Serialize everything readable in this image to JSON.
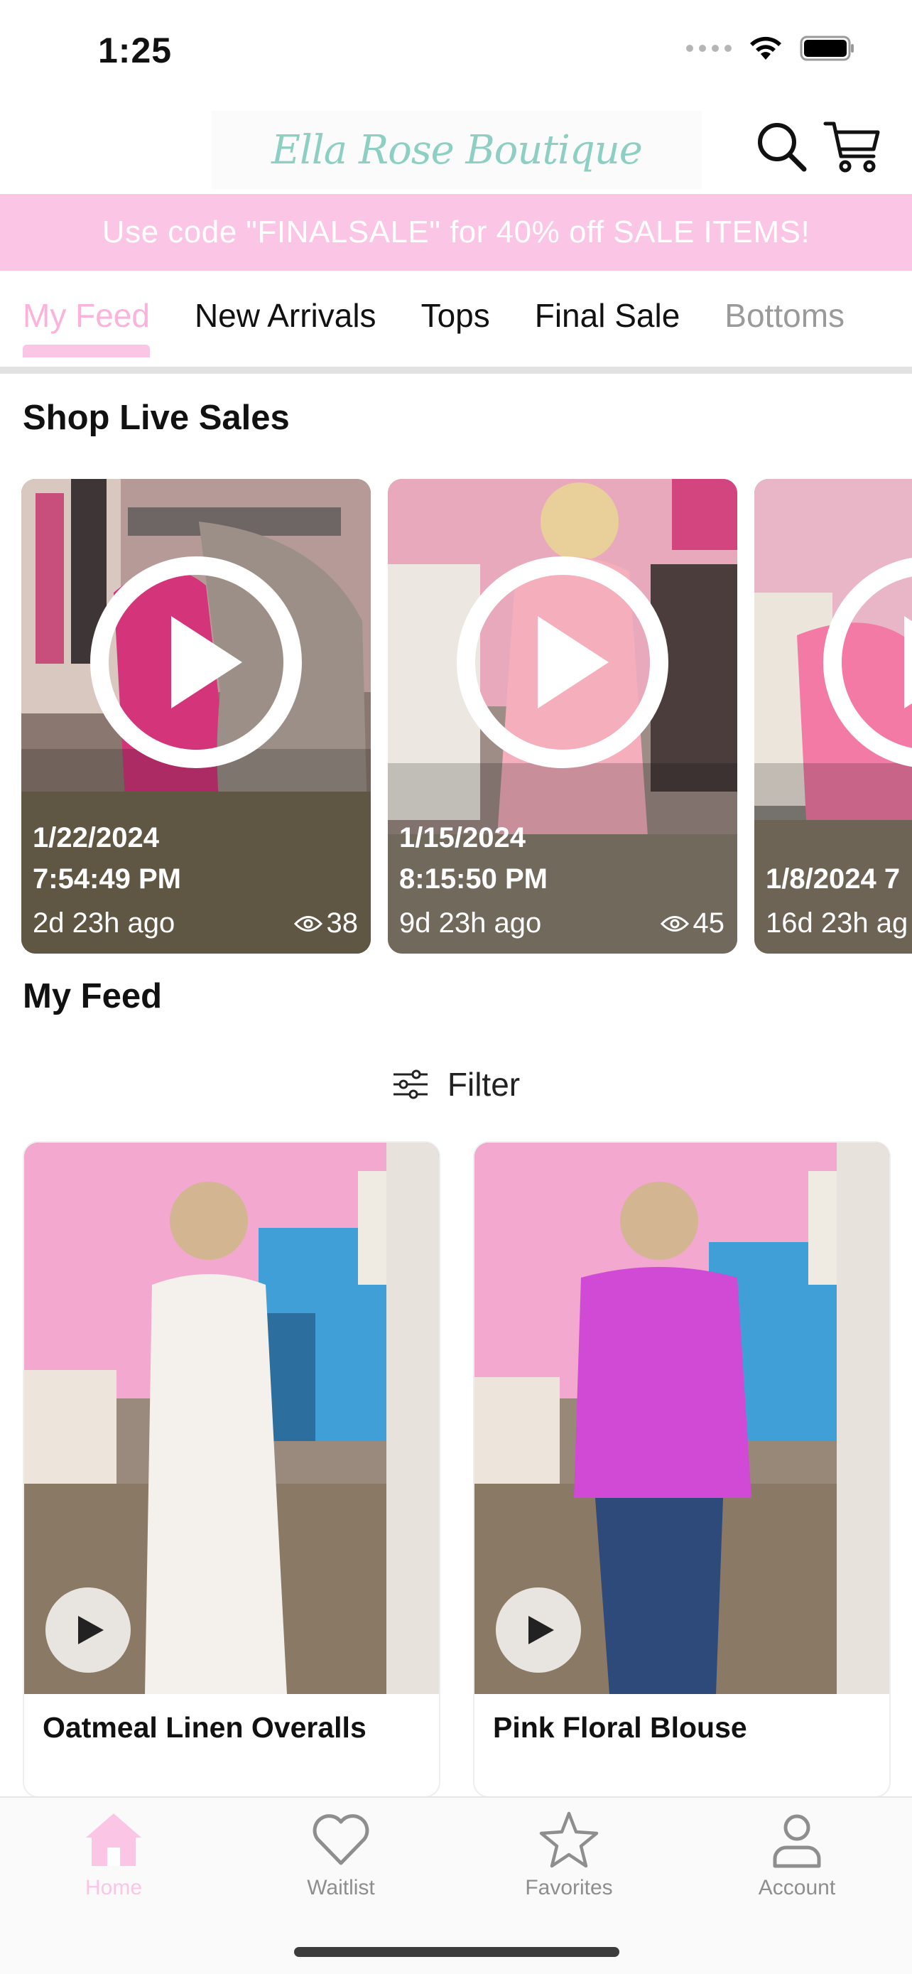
{
  "status_bar": {
    "time": "1:25"
  },
  "header": {
    "logo_text": "Ella Rose Boutique"
  },
  "promo": {
    "text": "Use code \"FINALSALE\" for 40% off SALE ITEMS!"
  },
  "tabs": [
    {
      "label": "My Feed"
    },
    {
      "label": "New Arrivals"
    },
    {
      "label": "Tops"
    },
    {
      "label": "Final Sale"
    },
    {
      "label": "Bottoms"
    }
  ],
  "live_section": {
    "title": "Shop Live Sales",
    "cards": [
      {
        "date": "1/22/2024",
        "time": "7:54:49 PM",
        "ago": "2d 23h ago",
        "views": "38"
      },
      {
        "date": "1/15/2024",
        "time": "8:15:50 PM",
        "ago": "9d 23h ago",
        "views": "45"
      },
      {
        "date": "1/8/2024 7",
        "time": "",
        "ago": "16d 23h ag",
        "views": ""
      }
    ]
  },
  "feed": {
    "title": "My Feed",
    "filter_label": "Filter",
    "products": [
      {
        "name": "Oatmeal Linen Overalls"
      },
      {
        "name": "Pink Floral Blouse"
      }
    ]
  },
  "bottom_nav": [
    {
      "label": "Home",
      "icon": "home-icon"
    },
    {
      "label": "Waitlist",
      "icon": "heart-icon"
    },
    {
      "label": "Favorites",
      "icon": "star-icon"
    },
    {
      "label": "Account",
      "icon": "person-icon"
    }
  ],
  "colors": {
    "accent_pink": "#fbc5e6",
    "logo_teal": "#8ecfc3",
    "tab_inactive": "#8e8e8e"
  }
}
